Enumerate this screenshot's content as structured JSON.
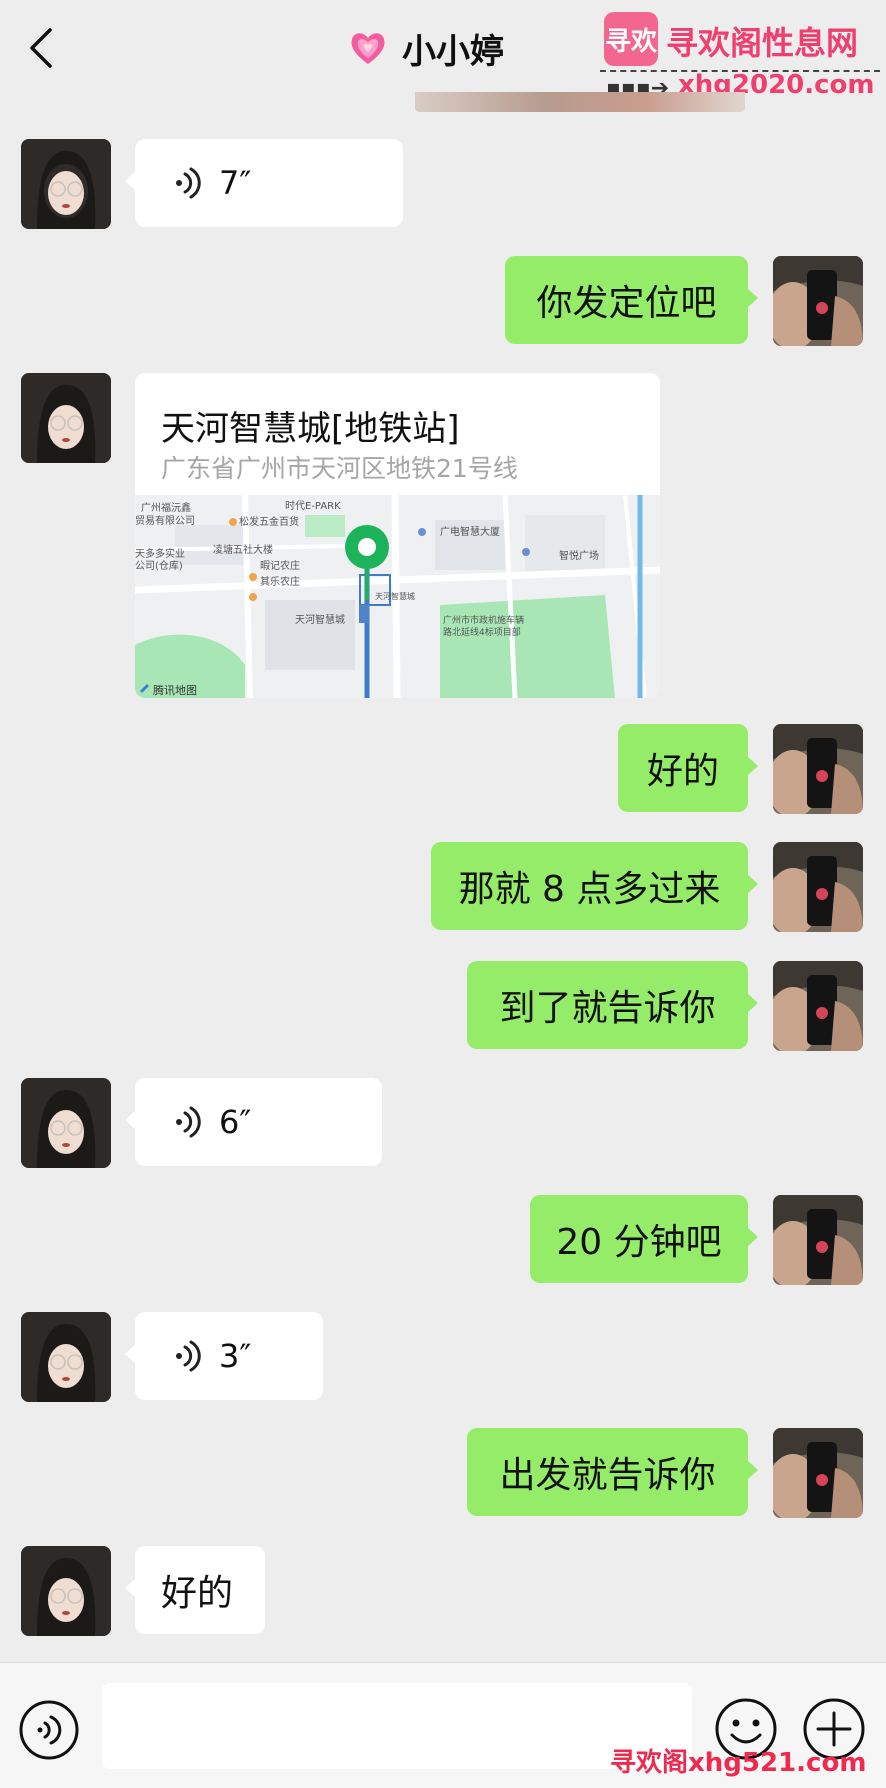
{
  "header": {
    "title": "小小婷",
    "back_icon": "chevron-left-icon",
    "title_icon": "pink-heart-icon"
  },
  "watermark": {
    "logo_text": "寻欢",
    "site_name": "寻欢阁性息网",
    "url_top": "xhg2020.com",
    "url_bottom": "寻欢阁xhg521.com",
    "brand_color": "#ee3f6e"
  },
  "messages": [
    {
      "side": "in",
      "type": "voice",
      "duration": "7″"
    },
    {
      "side": "out",
      "type": "text",
      "text": "你发定位吧"
    },
    {
      "side": "in",
      "type": "location",
      "title": "天河智慧城[地铁站]",
      "address": "广东省广州市天河区地铁21号线",
      "map": {
        "labels": [
          "时代E-PARK",
          "广州福沅鑫",
          "贸易有限公司",
          "松发五金百货",
          "凌塘五社大楼",
          "暇记农庄",
          "其乐农庄",
          "广电智慧大厦",
          "智悦广场",
          "天河智慧城",
          "天河智慧城",
          "广州市市政机施车辆",
          "路北延线4标项目部",
          "天多多实业",
          "公司(仓库)"
        ],
        "provider": "腾讯地图"
      }
    },
    {
      "side": "out",
      "type": "text",
      "text": "好的"
    },
    {
      "side": "out",
      "type": "text",
      "text": "那就 8 点多过来"
    },
    {
      "side": "out",
      "type": "text",
      "text": "到了就告诉你"
    },
    {
      "side": "in",
      "type": "voice",
      "duration": "6″"
    },
    {
      "side": "out",
      "type": "text",
      "text": "20 分钟吧"
    },
    {
      "side": "in",
      "type": "voice",
      "duration": "3″"
    },
    {
      "side": "out",
      "type": "text",
      "text": "出发就告诉你"
    },
    {
      "side": "in",
      "type": "text",
      "text": "好的"
    }
  ],
  "input": {
    "value": "",
    "placeholder": "",
    "voice_icon": "voice-toggle-icon",
    "emoji_icon": "emoji-icon",
    "plus_icon": "plus-icon"
  },
  "colors": {
    "background": "#ededed",
    "outgoing_bubble": "#95ec69",
    "incoming_bubble": "#ffffff",
    "map_pin": "#1db35a"
  }
}
